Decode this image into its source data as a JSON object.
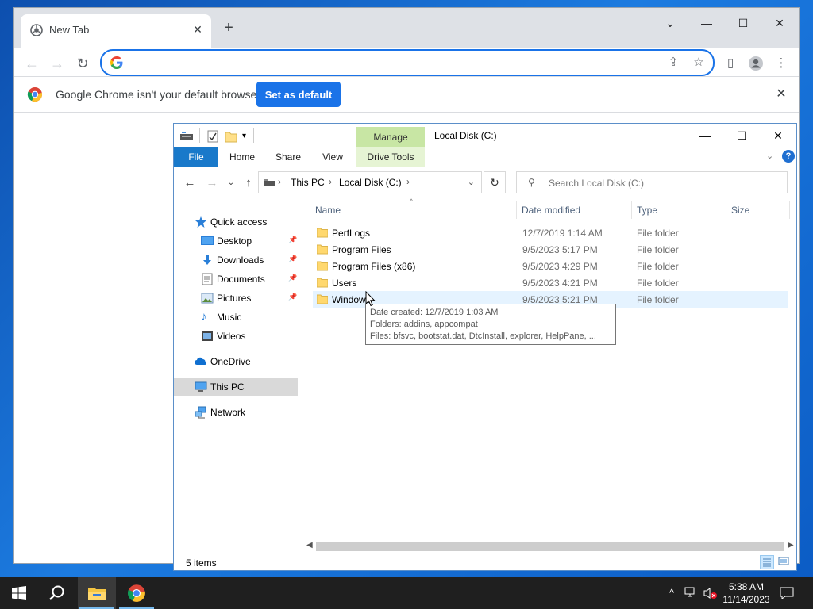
{
  "chrome": {
    "tab_title": "New Tab",
    "omnibox_placeholder": "",
    "infobar_message": "Google Chrome isn't your default browser",
    "set_default_label": "Set as default",
    "colors": {
      "accent": "#1a73e8",
      "tabstrip": "#dee1e6"
    }
  },
  "explorer": {
    "title": "Local Disk (C:)",
    "manage_label": "Manage",
    "ribbon_tabs": [
      "File",
      "Home",
      "Share",
      "View",
      "Drive Tools"
    ],
    "breadcrumb": [
      "This PC",
      "Local Disk (C:)"
    ],
    "search_placeholder": "Search Local Disk (C:)",
    "columns": [
      "Name",
      "Date modified",
      "Type",
      "Size"
    ],
    "nav": {
      "quick_access": "Quick access",
      "desktop": "Desktop",
      "downloads": "Downloads",
      "documents": "Documents",
      "pictures": "Pictures",
      "music": "Music",
      "videos": "Videos",
      "onedrive": "OneDrive",
      "this_pc": "This PC",
      "network": "Network"
    },
    "files": [
      {
        "name": "PerfLogs",
        "date": "12/7/2019 1:14 AM",
        "type": "File folder"
      },
      {
        "name": "Program Files",
        "date": "9/5/2023 5:17 PM",
        "type": "File folder"
      },
      {
        "name": "Program Files (x86)",
        "date": "9/5/2023 4:29 PM",
        "type": "File folder"
      },
      {
        "name": "Users",
        "date": "9/5/2023 4:21 PM",
        "type": "File folder"
      },
      {
        "name": "Windows",
        "date": "9/5/2023 5:21 PM",
        "type": "File folder"
      }
    ],
    "tooltip": {
      "line1": "Date created: 12/7/2019 1:03 AM",
      "line2": "Folders: addins, appcompat",
      "line3": "Files: bfsvc, bootstat.dat, DtcInstall, explorer, HelpPane, ..."
    },
    "status": "5 items"
  },
  "taskbar": {
    "time": "5:38 AM",
    "date": "11/14/2023"
  }
}
